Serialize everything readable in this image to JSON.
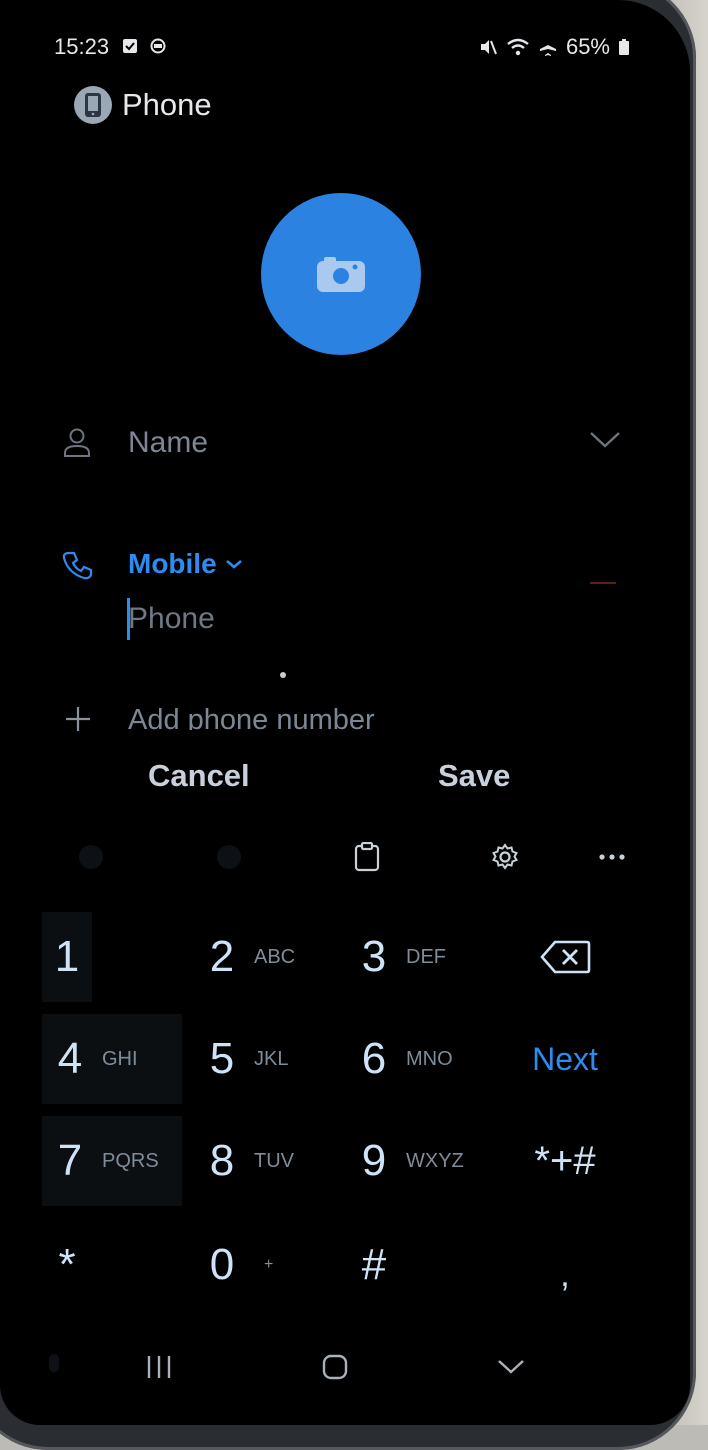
{
  "status_bar": {
    "time": "15:23",
    "battery": "65%"
  },
  "app": {
    "title": "Phone"
  },
  "form": {
    "name_placeholder": "Name",
    "phone_type_label": "Mobile",
    "phone_placeholder": "Phone",
    "add_phone_label": "Add phone number"
  },
  "actions": {
    "cancel_label": "Cancel",
    "save_label": "Save"
  },
  "keypad": {
    "keys": [
      {
        "digit": "1",
        "letters": ""
      },
      {
        "digit": "2",
        "letters": "ABC"
      },
      {
        "digit": "3",
        "letters": "DEF"
      },
      {
        "digit": "4",
        "letters": "GHI"
      },
      {
        "digit": "5",
        "letters": "JKL"
      },
      {
        "digit": "6",
        "letters": "MNO"
      },
      {
        "digit": "7",
        "letters": "PQRS"
      },
      {
        "digit": "8",
        "letters": "TUV"
      },
      {
        "digit": "9",
        "letters": "WXYZ"
      },
      {
        "digit": "*",
        "letters": ""
      },
      {
        "digit": "0",
        "letters": "+"
      },
      {
        "digit": "#",
        "letters": ""
      }
    ],
    "next_label": "Next",
    "symbols_label": "*+#",
    "comma_label": ","
  },
  "colors": {
    "accent": "#2e8bf0",
    "avatar": "#2c82e0",
    "background": "#000000"
  },
  "icons": [
    "person-icon",
    "phone-icon",
    "plus-icon",
    "camera-icon",
    "chevron-down-icon",
    "clipboard-icon",
    "gear-icon",
    "more-icon",
    "backspace-icon",
    "recents-nav-icon",
    "home-nav-icon",
    "back-nav-icon"
  ]
}
